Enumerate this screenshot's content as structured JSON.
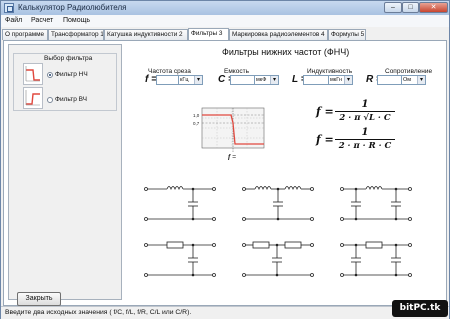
{
  "window": {
    "title": "Калькулятор Радиолюбителя",
    "controls": {
      "minimize": "–",
      "maximize": "□",
      "close": "✕"
    }
  },
  "menu": [
    "Файл",
    "Расчет",
    "Помощь"
  ],
  "tabs": [
    {
      "label": "О программе",
      "active": false
    },
    {
      "label": "Трансформатор 1",
      "active": false
    },
    {
      "label": "Катушка индуктивности 2",
      "active": false
    },
    {
      "label": "Фильтры 3",
      "active": true
    },
    {
      "label": "Маркировка радиоэлементов 4",
      "active": false
    },
    {
      "label": "Формулы 5",
      "active": false
    }
  ],
  "filter_select": {
    "title": "Выбор фильтра",
    "options": [
      {
        "label": "Фильтр НЧ",
        "selected": true
      },
      {
        "label": "Фильтр ВЧ",
        "selected": false
      }
    ]
  },
  "main": {
    "title": "Фильтры нижних частот (ФНЧ)",
    "params": [
      {
        "label": "Частота среза",
        "var": "f =",
        "value": "",
        "unit": "кГц"
      },
      {
        "label": "Емкость",
        "var": "C =",
        "value": "",
        "unit": "мкФ"
      },
      {
        "label": "Индуктивность",
        "var": "L =",
        "value": "",
        "unit": "мкГн"
      },
      {
        "label": "Сопротивление",
        "var": "R =",
        "value": "",
        "unit": "Ом"
      }
    ],
    "graph": {
      "y_labels": [
        "1,0",
        "0,7"
      ],
      "x_label": "f ="
    },
    "formulas": [
      {
        "lhs": "f =",
        "num": "1",
        "den": "2 · π √L · C"
      },
      {
        "lhs": "f =",
        "num": "1",
        "den": "2 · π · R · C"
      }
    ]
  },
  "buttons": {
    "close": "Закрыть"
  },
  "status": "Введите два исходных значения ( f/C, f/L, f/R, C/L или C/R).",
  "watermark": "bitPC.tk",
  "colors": {
    "titlebar": "#b8cde8",
    "graph_line": "#e0483e",
    "accent": "#1f3f6b"
  }
}
